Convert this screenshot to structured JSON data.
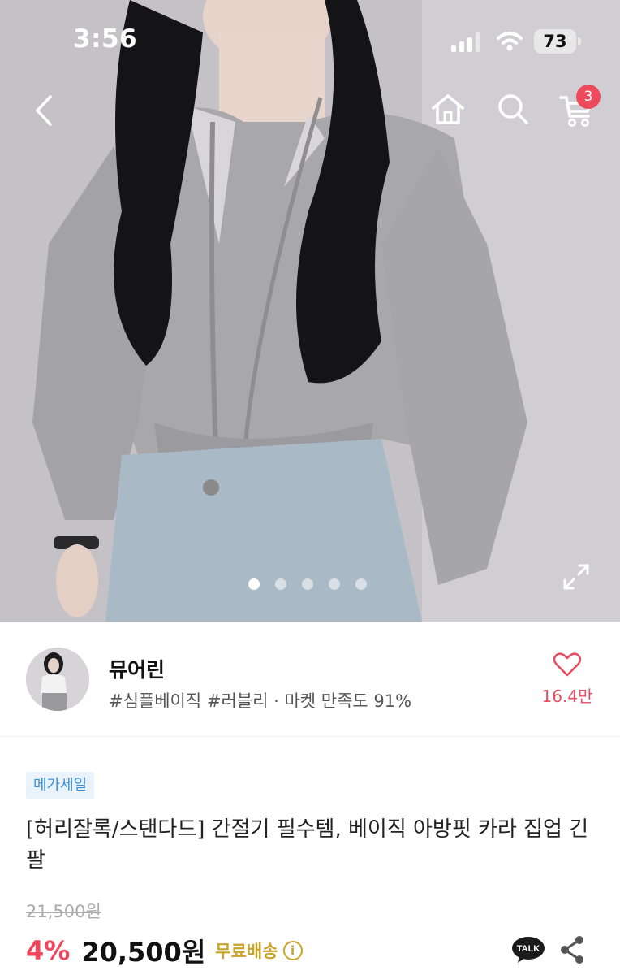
{
  "status_bar": {
    "time": "3:56",
    "battery": "73"
  },
  "nav": {
    "cart_count": "3"
  },
  "gallery": {
    "image_count": 5,
    "active_index": 0
  },
  "seller": {
    "name": "뮤어린",
    "tags": "#심플베이직 #러블리 · 마켓 만족도 91%",
    "likes": "16.4만"
  },
  "product": {
    "badge": "메가세일",
    "title": "[허리잘록/스탠다드] 간절기 필수템, 베이직 아방핏 카라 집업 긴팔",
    "original_price": "21,500원",
    "discount": "4%",
    "price": "20,500원",
    "shipping": "무료배송",
    "talk_label": "TALK"
  },
  "colors": {
    "accent": "#f0445a",
    "shipping": "#c9a32a",
    "badge_text": "#3a8fd6",
    "badge_bg": "#eaf3fb"
  }
}
